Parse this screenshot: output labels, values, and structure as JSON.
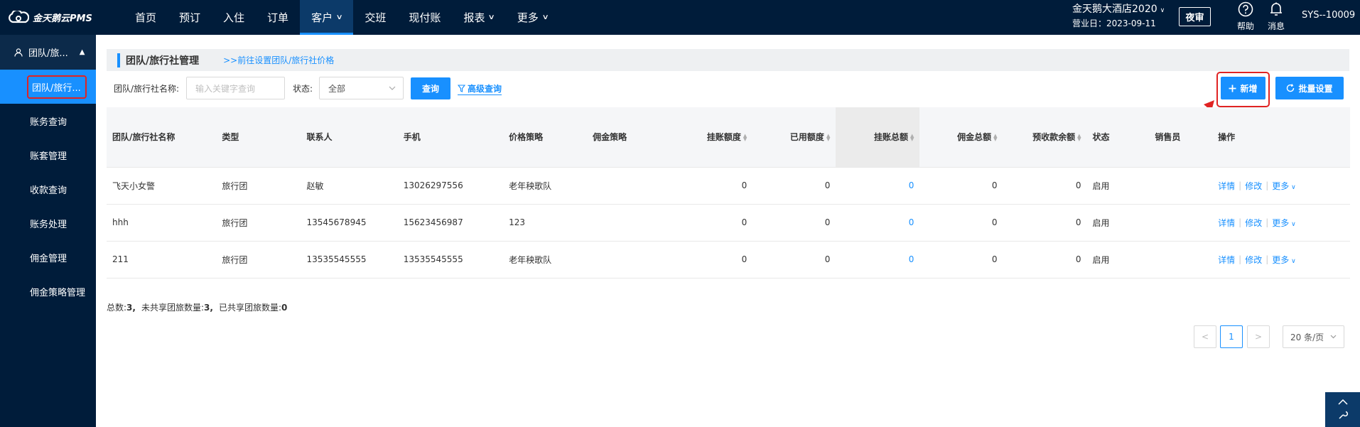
{
  "brand": {
    "logo_text": "金天鹅云PMS"
  },
  "nav": {
    "items": [
      {
        "label": "首页",
        "active": false,
        "dropdown": false
      },
      {
        "label": "预订",
        "active": false,
        "dropdown": false
      },
      {
        "label": "入住",
        "active": false,
        "dropdown": false
      },
      {
        "label": "订单",
        "active": false,
        "dropdown": false
      },
      {
        "label": "客户",
        "active": true,
        "dropdown": true
      },
      {
        "label": "交班",
        "active": false,
        "dropdown": false
      },
      {
        "label": "现付账",
        "active": false,
        "dropdown": false
      },
      {
        "label": "报表",
        "active": false,
        "dropdown": true
      },
      {
        "label": "更多",
        "active": false,
        "dropdown": true
      }
    ]
  },
  "header": {
    "hotel_name": "金天鹅大酒店2020",
    "business_date": "营业日：2023-09-11",
    "night_audit_label": "夜审",
    "help_label": "帮助",
    "message_label": "消息",
    "user": "SYS--10009"
  },
  "sidebar": {
    "group_label": "团队/旅...",
    "items": [
      {
        "label": "团队/旅行...",
        "active": true
      },
      {
        "label": "账务查询",
        "active": false
      },
      {
        "label": "账套管理",
        "active": false
      },
      {
        "label": "收款查询",
        "active": false
      },
      {
        "label": "账务处理",
        "active": false
      },
      {
        "label": "佣金管理",
        "active": false
      },
      {
        "label": "佣金策略管理",
        "active": false
      }
    ]
  },
  "page": {
    "title": "团队/旅行社管理",
    "price_link": ">>前往设置团队/旅行社价格"
  },
  "filters": {
    "name_label": "团队/旅行社名称:",
    "name_placeholder": "输入关键字查询",
    "status_label": "状态:",
    "status_value": "全部",
    "query_button": "查询",
    "advanced_label": "高级查询",
    "add_button": "新增",
    "batch_button": "批量设置"
  },
  "table": {
    "columns": [
      "团队/旅行社名称",
      "类型",
      "联系人",
      "手机",
      "价格策略",
      "佣金策略",
      "挂账额度",
      "已用额度",
      "挂账总额",
      "佣金总额",
      "预收款余额",
      "状态",
      "销售员",
      "操作"
    ],
    "rows": [
      {
        "name": "飞天小女警",
        "type": "旅行团",
        "contact": "赵敏",
        "phone": "13026297556",
        "price_policy": "老年秧歌队",
        "commission_policy": "",
        "credit_limit": "0",
        "used_limit": "0",
        "credit_total": "0",
        "commission_total": "0",
        "prepaid_balance": "0",
        "status": "启用",
        "sales": ""
      },
      {
        "name": "hhh",
        "type": "旅行团",
        "contact": "13545678945",
        "phone": "15623456987",
        "price_policy": "123",
        "commission_policy": "",
        "credit_limit": "0",
        "used_limit": "0",
        "credit_total": "0",
        "commission_total": "0",
        "prepaid_balance": "0",
        "status": "启用",
        "sales": ""
      },
      {
        "name": "211",
        "type": "旅行团",
        "contact": "13535545555",
        "phone": "13535545555",
        "price_policy": "老年秧歌队",
        "commission_policy": "",
        "credit_limit": "0",
        "used_limit": "0",
        "credit_total": "0",
        "commission_total": "0",
        "prepaid_balance": "0",
        "status": "启用",
        "sales": ""
      }
    ],
    "row_actions": {
      "detail": "详情",
      "edit": "修改",
      "more": "更多"
    }
  },
  "summary": {
    "total_label": "总数:",
    "total_value": "3,",
    "unshared_label": "未共享团旅数量:",
    "unshared_value": "3,",
    "shared_label": "已共享团旅数量:",
    "shared_value": "0"
  },
  "pagination": {
    "current_page": "1",
    "page_size": "20 条/页"
  },
  "colors": {
    "nav_bg": "#001c3a",
    "accent": "#1890ff",
    "highlight": "#e02323"
  }
}
